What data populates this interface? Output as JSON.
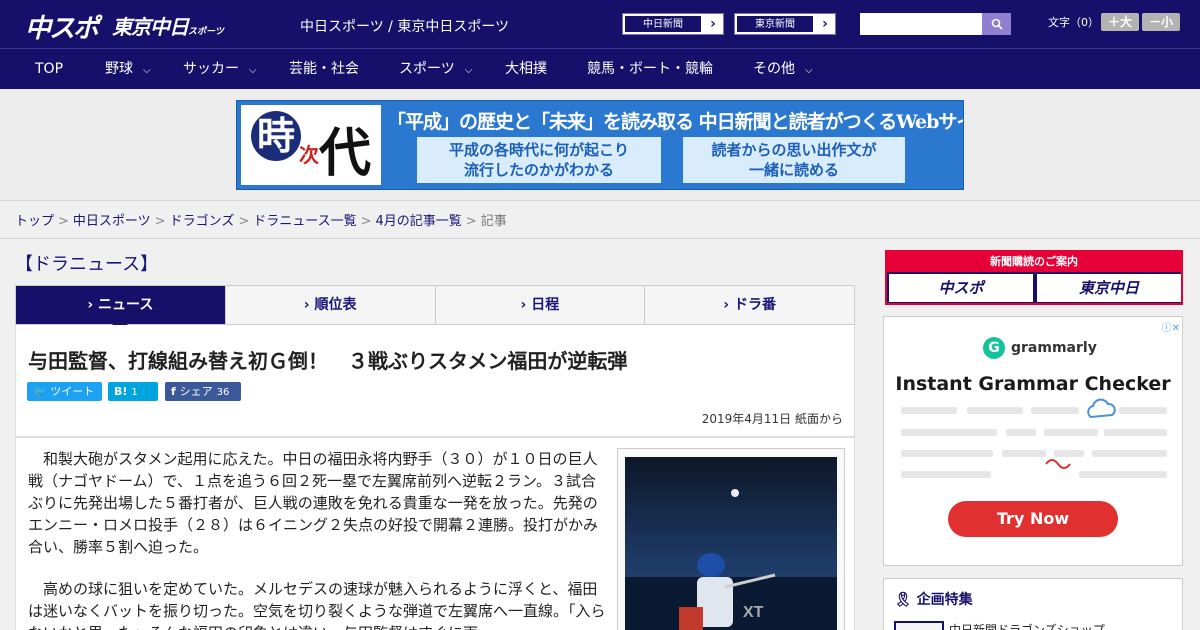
{
  "header": {
    "logo_chuspo": "中スポ",
    "logo_tokyo": "東京中日",
    "logo_tokyo_small": "スポーツ",
    "site_title": "中日スポーツ / 東京中日スポーツ",
    "ext_links": [
      "中日新聞",
      "東京新聞"
    ],
    "search_placeholder": "",
    "fontsize_label": "文字（0）",
    "fontsize_plus": "＋大",
    "fontsize_minus": "－小"
  },
  "nav": [
    {
      "label": "TOP",
      "chevron": false
    },
    {
      "label": "野球",
      "chevron": true
    },
    {
      "label": "サッカー",
      "chevron": true
    },
    {
      "label": "芸能・社会",
      "chevron": false
    },
    {
      "label": "スポーツ",
      "chevron": true
    },
    {
      "label": "大相撲",
      "chevron": false
    },
    {
      "label": "競馬・ボート・競輪",
      "chevron": false
    },
    {
      "label": "その他",
      "chevron": true
    }
  ],
  "banner": {
    "logo_char1": "時",
    "logo_char2": "次",
    "logo_char3": "代",
    "headline": "「平成」の歴史と「未来」を読み取る  中日新聞と読者がつくるWebサイト",
    "box1": "平成の各時代に何が起こり\n流行したのかがわかる",
    "box2": "読者からの思い出作文が\n一緒に読める"
  },
  "breadcrumb": [
    "トップ",
    "中日スポーツ",
    "ドラゴンズ",
    "ドラニュース一覧",
    "4月の記事一覧"
  ],
  "breadcrumb_current": "記事",
  "section_title": "【ドラニュース】",
  "tabs": [
    "ニュース",
    "順位表",
    "日程",
    "ドラ番"
  ],
  "article": {
    "headline": "与田監督、打線組み替え初Ｇ倒！　３戦ぶりスタメン福田が逆転弾",
    "share": {
      "tweet": "ツイート",
      "hatena": "B!",
      "hatena_count": "1",
      "facebook": "シェア",
      "facebook_count": "36"
    },
    "date": "2019年4月11日 紙面から",
    "paragraphs": [
      "和製大砲がスタメン起用に応えた。中日の福田永将内野手（３０）が１０日の巨人戦（ナゴヤドーム）で、１点を追う６回２死一塁で左翼席前列へ逆転２ラン。３試合ぶりに先発出場した５番打者が、巨人戦の連敗を免れる貴重な一発を放った。先発のエンニー・ロメロ投手（２８）は６イニング２失点の好投で開幕２連勝。投打がかみ合い、勝率５割へ迫った。",
      "高めの球に狙いを定めていた。メルセデスの速球が魅入られるように浮くと、福田は迷いなくバットを振り切った。空気を切り裂くような弾道で左翼席へ一直線。「入らないかと思った」そんな福田の印象とは違い、与田監督はすぐに両"
    ]
  },
  "sidebar": {
    "subscribe_label": "新聞購読のご案内",
    "subscribe_left": "中スポ",
    "subscribe_right": "東京中日",
    "ad_brand": "grammarly",
    "ad_title": "Instant Grammar Checker",
    "ad_cta": "Try Now",
    "ad_close": "ⓘ✕",
    "feature_title": "企画特集",
    "feature_item": "中日新聞ドラゴンズショップ"
  }
}
